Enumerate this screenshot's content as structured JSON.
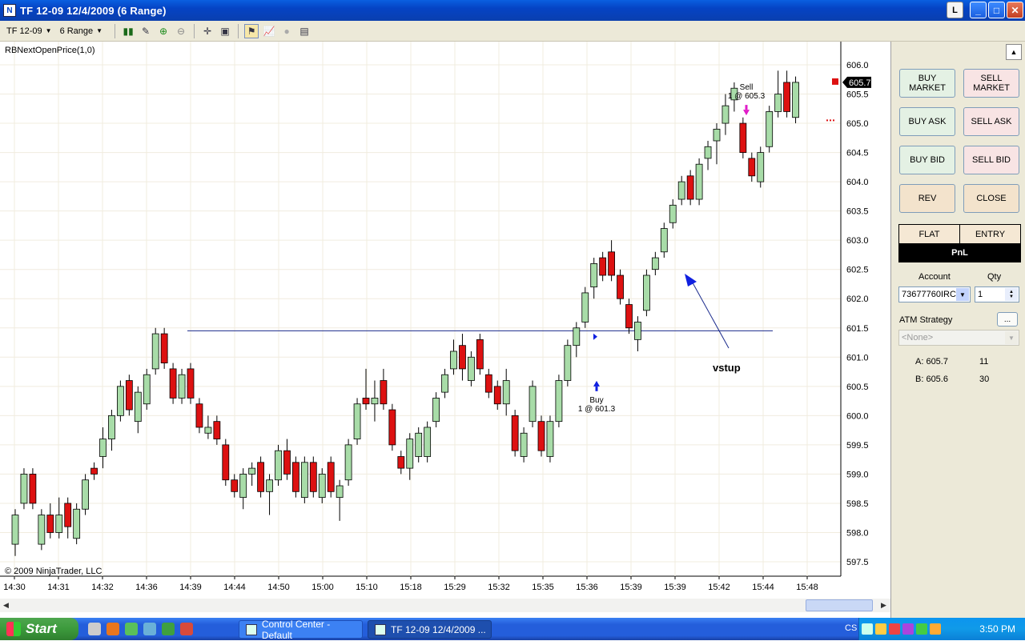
{
  "window": {
    "title": "TF 12-09  12/4/2009 (6 Range)",
    "btn_l": "L"
  },
  "toolbar": {
    "instrument": "TF 12-09",
    "period": "6 Range"
  },
  "chart": {
    "indicator_label": "RBNextOpenPrice(1,0)",
    "copyright": "© 2009 NinjaTrader, LLC",
    "last_price_label": "605.7",
    "vstup_label": "vstup",
    "buy_marker": {
      "title": "Buy",
      "detail": "1 @ 601.3"
    },
    "sell_marker": {
      "title": "Sell",
      "detail": "1 @ 605.3"
    }
  },
  "chart_data": {
    "type": "candlestick",
    "ylim": [
      597.4,
      606.3
    ],
    "y_ticks": [
      "606.0",
      "605.5",
      "605.0",
      "604.5",
      "604.0",
      "603.5",
      "603.0",
      "602.5",
      "602.0",
      "601.5",
      "601.0",
      "600.5",
      "600.0",
      "599.5",
      "599.0",
      "598.5",
      "598.0",
      "597.5"
    ],
    "x_ticks": [
      "14:30",
      "14:31",
      "14:32",
      "14:36",
      "14:39",
      "14:44",
      "14:50",
      "15:00",
      "15:10",
      "15:18",
      "15:29",
      "15:32",
      "15:35",
      "15:36",
      "15:39",
      "15:39",
      "15:42",
      "15:44",
      "15:48"
    ],
    "horizontal_line_price": 601.45,
    "colors": {
      "up": "#a8dca8",
      "down": "#dd1111",
      "gridline": "#f1ecdf",
      "line": "#1a2a8c"
    },
    "candles": [
      {
        "o": 597.8,
        "c": 598.3,
        "h": 598.4,
        "l": 597.6
      },
      {
        "o": 598.5,
        "c": 599.0,
        "h": 599.1,
        "l": 598.4
      },
      {
        "o": 599.0,
        "c": 598.5,
        "h": 599.1,
        "l": 598.4
      },
      {
        "o": 597.8,
        "c": 598.3,
        "h": 598.4,
        "l": 597.7
      },
      {
        "o": 598.3,
        "c": 598.0,
        "h": 598.5,
        "l": 597.9
      },
      {
        "o": 598.0,
        "c": 598.3,
        "h": 598.6,
        "l": 597.9
      },
      {
        "o": 598.5,
        "c": 598.1,
        "h": 598.6,
        "l": 597.9
      },
      {
        "o": 597.9,
        "c": 598.4,
        "h": 598.5,
        "l": 597.8
      },
      {
        "o": 598.4,
        "c": 598.9,
        "h": 599.0,
        "l": 598.3
      },
      {
        "o": 599.1,
        "c": 599.0,
        "h": 599.2,
        "l": 598.9
      },
      {
        "o": 599.3,
        "c": 599.6,
        "h": 599.8,
        "l": 599.1
      },
      {
        "o": 599.6,
        "c": 600.0,
        "h": 600.1,
        "l": 599.4
      },
      {
        "o": 600.0,
        "c": 600.5,
        "h": 600.6,
        "l": 599.9
      },
      {
        "o": 600.6,
        "c": 600.1,
        "h": 600.7,
        "l": 600.0
      },
      {
        "o": 599.9,
        "c": 600.4,
        "h": 600.5,
        "l": 599.7
      },
      {
        "o": 600.2,
        "c": 600.7,
        "h": 600.8,
        "l": 600.1
      },
      {
        "o": 600.8,
        "c": 601.4,
        "h": 601.5,
        "l": 600.7
      },
      {
        "o": 601.4,
        "c": 600.9,
        "h": 601.5,
        "l": 600.8
      },
      {
        "o": 600.8,
        "c": 600.3,
        "h": 600.9,
        "l": 600.2
      },
      {
        "o": 600.3,
        "c": 600.7,
        "h": 600.8,
        "l": 600.2
      },
      {
        "o": 600.8,
        "c": 600.3,
        "h": 600.9,
        "l": 600.2
      },
      {
        "o": 600.2,
        "c": 599.8,
        "h": 600.3,
        "l": 599.7
      },
      {
        "o": 599.7,
        "c": 599.8,
        "h": 600.0,
        "l": 599.6
      },
      {
        "o": 599.9,
        "c": 599.6,
        "h": 600.0,
        "l": 599.5
      },
      {
        "o": 599.5,
        "c": 598.9,
        "h": 599.6,
        "l": 598.8
      },
      {
        "o": 598.9,
        "c": 598.7,
        "h": 599.0,
        "l": 598.6
      },
      {
        "o": 598.6,
        "c": 599.0,
        "h": 599.1,
        "l": 598.4
      },
      {
        "o": 599.0,
        "c": 599.1,
        "h": 599.2,
        "l": 598.8
      },
      {
        "o": 599.2,
        "c": 598.7,
        "h": 599.3,
        "l": 598.6
      },
      {
        "o": 598.7,
        "c": 598.9,
        "h": 599.0,
        "l": 598.3
      },
      {
        "o": 598.9,
        "c": 599.4,
        "h": 599.5,
        "l": 598.8
      },
      {
        "o": 599.4,
        "c": 599.0,
        "h": 599.6,
        "l": 598.9
      },
      {
        "o": 599.2,
        "c": 598.7,
        "h": 599.3,
        "l": 598.6
      },
      {
        "o": 598.6,
        "c": 599.2,
        "h": 599.3,
        "l": 598.5
      },
      {
        "o": 599.2,
        "c": 598.7,
        "h": 599.3,
        "l": 598.6
      },
      {
        "o": 598.6,
        "c": 599.0,
        "h": 599.1,
        "l": 598.5
      },
      {
        "o": 599.2,
        "c": 598.7,
        "h": 599.3,
        "l": 598.6
      },
      {
        "o": 598.6,
        "c": 598.8,
        "h": 598.9,
        "l": 598.2
      },
      {
        "o": 598.9,
        "c": 599.5,
        "h": 599.6,
        "l": 598.8
      },
      {
        "o": 599.6,
        "c": 600.2,
        "h": 600.3,
        "l": 599.5
      },
      {
        "o": 600.3,
        "c": 600.2,
        "h": 600.8,
        "l": 600.1
      },
      {
        "o": 600.2,
        "c": 600.3,
        "h": 600.6,
        "l": 599.9
      },
      {
        "o": 600.6,
        "c": 600.2,
        "h": 600.8,
        "l": 600.1
      },
      {
        "o": 600.1,
        "c": 599.5,
        "h": 600.2,
        "l": 599.4
      },
      {
        "o": 599.3,
        "c": 599.1,
        "h": 599.4,
        "l": 599.0
      },
      {
        "o": 599.1,
        "c": 599.6,
        "h": 599.7,
        "l": 598.9
      },
      {
        "o": 599.3,
        "c": 599.7,
        "h": 599.8,
        "l": 599.2
      },
      {
        "o": 599.3,
        "c": 599.8,
        "h": 599.9,
        "l": 599.2
      },
      {
        "o": 599.9,
        "c": 600.3,
        "h": 600.4,
        "l": 599.8
      },
      {
        "o": 600.4,
        "c": 600.7,
        "h": 600.8,
        "l": 600.3
      },
      {
        "o": 600.8,
        "c": 601.1,
        "h": 601.3,
        "l": 600.7
      },
      {
        "o": 601.2,
        "c": 600.8,
        "h": 601.4,
        "l": 600.6
      },
      {
        "o": 600.6,
        "c": 601.0,
        "h": 601.1,
        "l": 600.5
      },
      {
        "o": 601.3,
        "c": 600.8,
        "h": 601.4,
        "l": 600.7
      },
      {
        "o": 600.7,
        "c": 600.4,
        "h": 600.8,
        "l": 600.3
      },
      {
        "o": 600.5,
        "c": 600.2,
        "h": 600.6,
        "l": 600.1
      },
      {
        "o": 600.2,
        "c": 600.6,
        "h": 600.8,
        "l": 600.0
      },
      {
        "o": 600.0,
        "c": 599.4,
        "h": 600.1,
        "l": 599.3
      },
      {
        "o": 599.3,
        "c": 599.7,
        "h": 599.8,
        "l": 599.2
      },
      {
        "o": 599.9,
        "c": 600.5,
        "h": 600.6,
        "l": 599.8
      },
      {
        "o": 599.9,
        "c": 599.4,
        "h": 600.0,
        "l": 599.3
      },
      {
        "o": 599.3,
        "c": 599.9,
        "h": 600.0,
        "l": 599.2
      },
      {
        "o": 599.9,
        "c": 600.6,
        "h": 600.7,
        "l": 599.8
      },
      {
        "o": 600.6,
        "c": 601.2,
        "h": 601.3,
        "l": 600.5
      },
      {
        "o": 601.2,
        "c": 601.5,
        "h": 601.6,
        "l": 601.0
      },
      {
        "o": 601.6,
        "c": 602.1,
        "h": 602.2,
        "l": 601.5
      },
      {
        "o": 602.2,
        "c": 602.6,
        "h": 602.7,
        "l": 602.0
      },
      {
        "o": 602.7,
        "c": 602.4,
        "h": 602.8,
        "l": 602.3
      },
      {
        "o": 602.8,
        "c": 602.4,
        "h": 603.0,
        "l": 602.3
      },
      {
        "o": 602.4,
        "c": 602.0,
        "h": 602.5,
        "l": 601.9
      },
      {
        "o": 601.9,
        "c": 601.5,
        "h": 602.0,
        "l": 601.4
      },
      {
        "o": 601.3,
        "c": 601.6,
        "h": 601.7,
        "l": 601.1
      },
      {
        "o": 601.8,
        "c": 602.4,
        "h": 602.5,
        "l": 601.7
      },
      {
        "o": 602.5,
        "c": 602.7,
        "h": 602.8,
        "l": 602.4
      },
      {
        "o": 602.8,
        "c": 603.2,
        "h": 603.3,
        "l": 602.7
      },
      {
        "o": 603.3,
        "c": 603.6,
        "h": 603.7,
        "l": 603.2
      },
      {
        "o": 603.7,
        "c": 604.0,
        "h": 604.1,
        "l": 603.6
      },
      {
        "o": 604.1,
        "c": 603.7,
        "h": 604.2,
        "l": 603.6
      },
      {
        "o": 603.7,
        "c": 604.3,
        "h": 604.4,
        "l": 603.6
      },
      {
        "o": 604.4,
        "c": 604.6,
        "h": 604.7,
        "l": 604.2
      },
      {
        "o": 604.7,
        "c": 604.9,
        "h": 605.0,
        "l": 604.3
      },
      {
        "o": 605.0,
        "c": 605.3,
        "h": 605.5,
        "l": 604.8
      },
      {
        "o": 605.4,
        "c": 605.6,
        "h": 605.7,
        "l": 605.2
      },
      {
        "o": 605.0,
        "c": 604.5,
        "h": 605.1,
        "l": 604.4
      },
      {
        "o": 604.4,
        "c": 604.1,
        "h": 604.5,
        "l": 604.0
      },
      {
        "o": 604.0,
        "c": 604.5,
        "h": 604.6,
        "l": 603.9
      },
      {
        "o": 604.6,
        "c": 605.2,
        "h": 605.3,
        "l": 604.5
      },
      {
        "o": 605.2,
        "c": 605.5,
        "h": 605.9,
        "l": 605.1
      },
      {
        "o": 605.7,
        "c": 605.2,
        "h": 605.9,
        "l": 605.1
      },
      {
        "o": 605.1,
        "c": 605.7,
        "h": 605.8,
        "l": 605.0
      }
    ]
  },
  "panel": {
    "buy_market": "BUY\nMARKET",
    "sell_market": "SELL\nMARKET",
    "buy_ask": "BUY ASK",
    "sell_ask": "SELL ASK",
    "buy_bid": "BUY BID",
    "sell_bid": "SELL BID",
    "rev": "REV",
    "close": "CLOSE",
    "position": "FLAT",
    "entry": "ENTRY",
    "pnl": "PnL",
    "account_label": "Account",
    "account_value": "73677760IRC",
    "qty_label": "Qty",
    "qty_value": "1",
    "atm_label": "ATM Strategy",
    "atm_btn": "...",
    "atm_value": "<None>",
    "ask_label": "A: 605.7",
    "ask_size": "11",
    "bid_label": "B: 605.6",
    "bid_size": "30"
  },
  "taskbar": {
    "start": "Start",
    "task1": "Control Center - Default",
    "task2": "TF 12-09  12/4/2009 ...",
    "lang": "CS",
    "clock": "3:50 PM"
  }
}
